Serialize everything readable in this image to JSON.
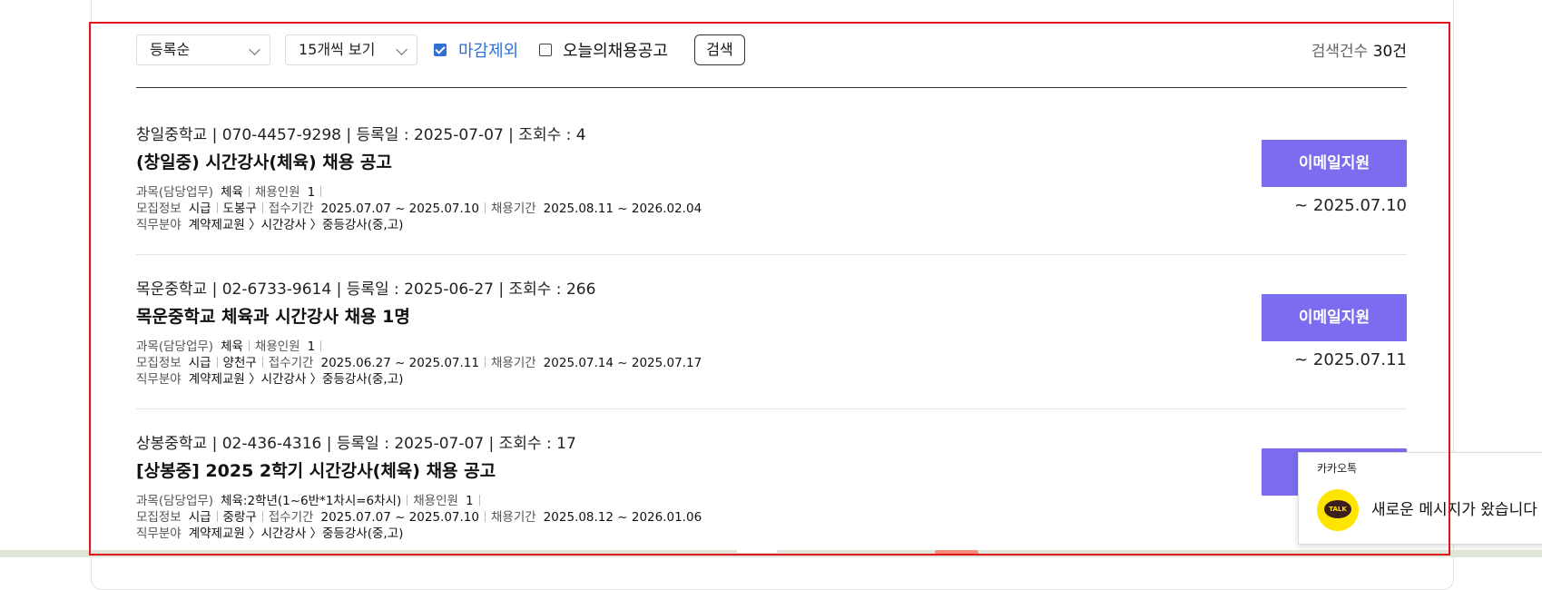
{
  "toolbar": {
    "sort_select": "등록순",
    "per_page_select": "15개씩 보기",
    "exclude_closed": {
      "label": "마감제외",
      "checked": true
    },
    "today_only": {
      "label": "오늘의채용공고",
      "checked": false
    },
    "search_label": "검색",
    "count_label": "검색건수",
    "count_value": "30건"
  },
  "labels": {
    "subject": "과목(담당업무)",
    "headcount": "채용인원",
    "recruit_info": "모집정보",
    "receipt_period": "접수기간",
    "hire_period": "채용기간",
    "job_field": "직무분야"
  },
  "jobs": [
    {
      "meta": "창일중학교 | 070-4457-9298 | 등록일 : 2025-07-07 | 조회수 : 4",
      "title": "(창일중) 시간강사(체육) 채용 공고",
      "subject": "체육",
      "headcount": "1",
      "pay": "시급",
      "district": "도봉구",
      "receipt_period": "2025.07.07 ~ 2025.07.10",
      "hire_period": "2025.08.11 ~ 2026.02.04",
      "job_field": "계약제교원 〉시간강사 〉중등강사(중,고)",
      "apply_label": "이메일지원",
      "deadline": "~ 2025.07.10"
    },
    {
      "meta": "목운중학교 | 02-6733-9614 | 등록일 : 2025-06-27 | 조회수 : 266",
      "title": "목운중학교 체육과 시간강사 채용 1명",
      "subject": "체육",
      "headcount": "1",
      "pay": "시급",
      "district": "양천구",
      "receipt_period": "2025.06.27 ~ 2025.07.11",
      "hire_period": "2025.07.14 ~ 2025.07.17",
      "job_field": "계약제교원 〉시간강사 〉중등강사(중,고)",
      "apply_label": "이메일지원",
      "deadline": "~ 2025.07.11"
    },
    {
      "meta": "상봉중학교 | 02-436-4316 | 등록일 : 2025-07-07 | 조회수 : 17",
      "title": "[상봉중] 2025 2학기 시간강사(체육) 채용 공고",
      "subject": "체육:2학년(1~6반*1차시=6차시)",
      "headcount": "1",
      "pay": "시급",
      "district": "중랑구",
      "receipt_period": "2025.07.07 ~ 2025.07.10",
      "hire_period": "2025.08.12 ~ 2026.01.06",
      "job_field": "계약제교원 〉시간강사 〉중등강사(중,고)"
    }
  ],
  "toast": {
    "app_name": "카카오톡",
    "icon_text": "TALK",
    "message": "새로운 메시지가 왔습니다"
  }
}
